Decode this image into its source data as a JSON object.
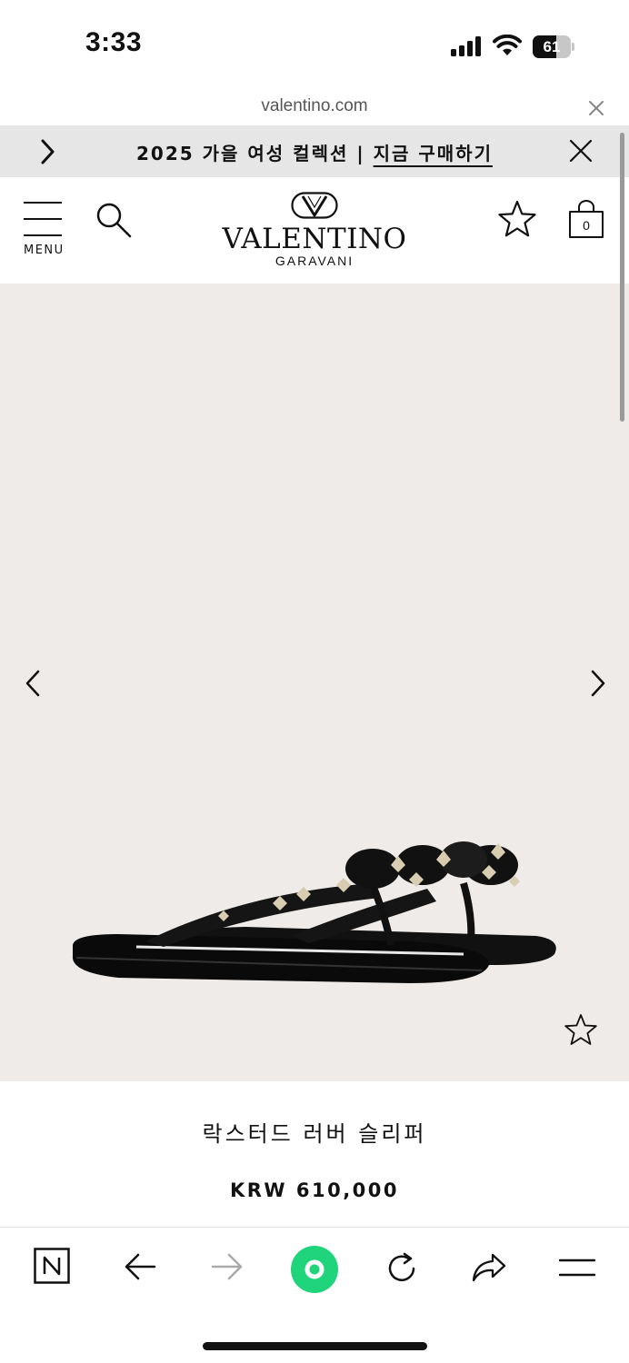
{
  "status_bar": {
    "time": "3:33",
    "battery_level": "61",
    "battery_fraction": 0.61,
    "icons": [
      "cellular-signal-icon",
      "wifi-icon",
      "battery-icon"
    ]
  },
  "browser": {
    "url": "valentino.com"
  },
  "promo_banner": {
    "text": "2025 가을 여성 컬렉션 |",
    "link_text": "지금 구매하기"
  },
  "header": {
    "menu_label": "MENU",
    "logo_text": "VALENTINO",
    "logo_subtext": "GARAVANI",
    "bag_count": "0"
  },
  "product": {
    "name": "락스터드 러버 슬리퍼",
    "price": "KRW 610,000",
    "image_background": "#efebe8"
  },
  "toolbar": {
    "items": [
      "n-app-icon",
      "back-arrow-icon",
      "forward-arrow-icon",
      "home-circle-icon",
      "reload-icon",
      "share-icon",
      "menu-lines-icon"
    ],
    "accent_color": "#1fd47a"
  }
}
